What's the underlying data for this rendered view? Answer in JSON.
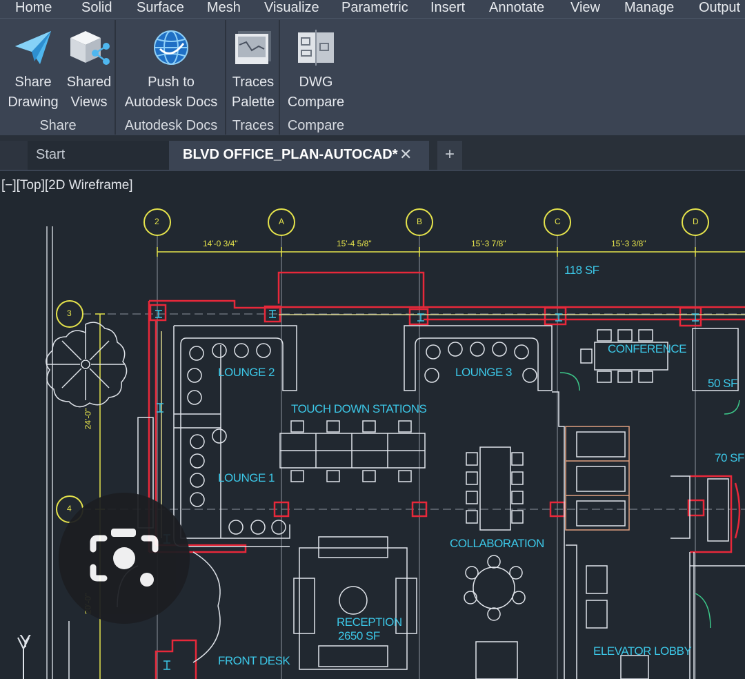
{
  "menu": [
    "Home",
    "Solid",
    "Surface",
    "Mesh",
    "Visualize",
    "Parametric",
    "Insert",
    "Annotate",
    "View",
    "Manage",
    "Output"
  ],
  "ribbon": {
    "share_drawing": [
      "Share",
      "Drawing"
    ],
    "shared_views": [
      "Shared",
      "Views"
    ],
    "share_panel": "Share",
    "push_docs": [
      "Push to",
      "Autodesk Docs"
    ],
    "docs_panel": "Autodesk Docs",
    "traces_palette": [
      "Traces",
      "Palette"
    ],
    "traces_panel": "Traces",
    "dwg_compare": [
      "DWG",
      "Compare"
    ],
    "compare_panel": "Compare"
  },
  "tabs": {
    "start": "Start",
    "active": "BLVD OFFICE_PLAN-AUTOCAD*",
    "close": "✕",
    "new": "+"
  },
  "viewport": {
    "label": "[−][Top][2D Wireframe]"
  },
  "drawing": {
    "rooms": {
      "lounge2": "LOUNGE 2",
      "lounge3": "LOUNGE 3",
      "lounge1": "LOUNGE 1",
      "conference": "CONFERENCE",
      "touchdown": "TOUCH DOWN STATIONS",
      "collaboration": "COLLABORATION",
      "reception": "RECEPTION",
      "reception_area": "2650 SF",
      "front_desk": "FRONT DESK",
      "elevator_lobby": "ELEVATOR LOBBY",
      "area_118": "118 SF",
      "area_50": "50 SF",
      "area_70": "70 SF"
    },
    "grid_bubbles": [
      "2",
      "A",
      "B",
      "C",
      "D"
    ],
    "row_bubbles": [
      "3",
      "4"
    ],
    "dimensions": [
      "14'-0 3/4\"",
      "15'-4 5/8\"",
      "15'-3 7/8\"",
      "15'-3 3/8\"",
      "24'-0\"",
      "20'-0\""
    ],
    "axis_y": "Y"
  },
  "colors": {
    "wall": "#e8283a",
    "room_text": "#3cc8e8",
    "dimension": "#e6e44c",
    "linework": "#e0e4ea"
  }
}
